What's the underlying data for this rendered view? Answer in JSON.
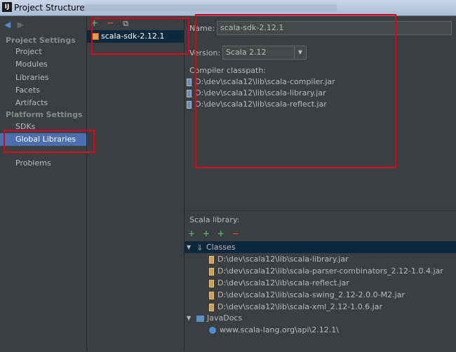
{
  "window": {
    "app_icon": "IJ",
    "title": "Project Structure"
  },
  "left_nav": {
    "project_settings_header": "Project Settings",
    "project_items": [
      "Project",
      "Modules",
      "Libraries",
      "Facets",
      "Artifacts"
    ],
    "platform_settings_header": "Platform Settings",
    "platform_items": [
      "SDKs",
      "Global Libraries"
    ],
    "selected": "Global Libraries",
    "problems": "Problems"
  },
  "middle": {
    "tools": {
      "add": "+",
      "remove": "−",
      "copy": "⧉"
    },
    "selected_library": "scala-sdk-2.12.1"
  },
  "details": {
    "name_label": "Name:",
    "name_value": "scala-sdk-2.12.1",
    "version_label": "Version:",
    "version_value": "Scala 2.12",
    "classpath_label": "Compiler classpath:",
    "classpath": [
      "D:\\dev\\scala12\\lib\\scala-compiler.jar",
      "D:\\dev\\scala12\\lib\\scala-library.jar",
      "D:\\dev\\scala12\\lib\\scala-reflect.jar"
    ]
  },
  "scala_library": {
    "label": "Scala library:",
    "tools": {
      "add": "+",
      "add_class": "+",
      "add_doc": "+",
      "remove": "−"
    },
    "classes_label": "Classes",
    "classes": [
      "D:\\dev\\scala12\\lib\\scala-library.jar",
      "D:\\dev\\scala12\\lib\\scala-parser-combinators_2.12-1.0.4.jar",
      "D:\\dev\\scala12\\lib\\scala-reflect.jar",
      "D:\\dev\\scala12\\lib\\scala-swing_2.12-2.0.0-M2.jar",
      "D:\\dev\\scala12\\lib\\scala-xml_2.12-1.0.6.jar"
    ],
    "javadocs_label": "JavaDocs",
    "javadocs": [
      "www.scala-lang.org\\api\\2.12.1\\"
    ]
  },
  "colors": {
    "background": "#3c3f41",
    "selection": "#4b6eaf",
    "annotation_red": "#e3001b"
  }
}
